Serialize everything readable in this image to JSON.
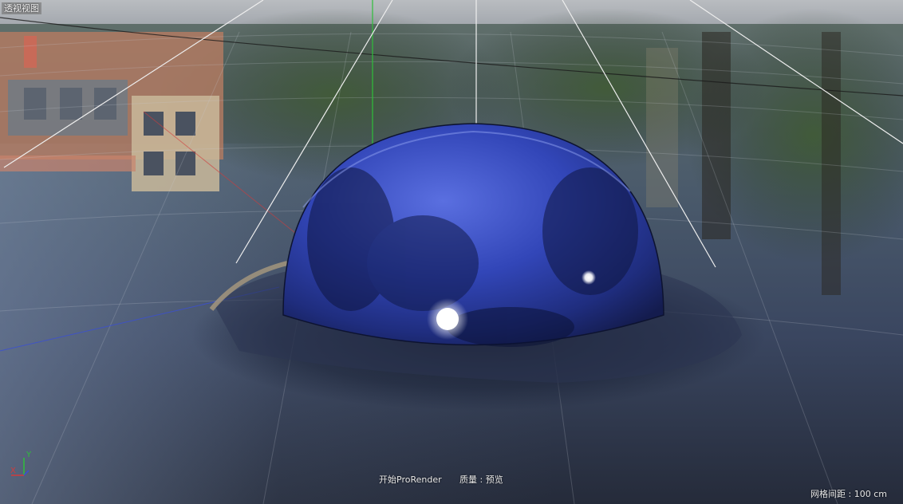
{
  "viewport": {
    "title": "透视视图"
  },
  "hud": {
    "render_start": "开始ProRender",
    "render_quality": "质量 : 预览",
    "grid_spacing": "网格间距 : 100 cm"
  },
  "axis_gizmo": {
    "x_label": "X",
    "y_label": "Y"
  },
  "colors": {
    "sky_top": "#aeb4ba",
    "floor_dark": "#2a3242",
    "floor_light": "#6a7f9a",
    "sphere_blue": "#2a3ea8",
    "axis_x": "#d23b3b",
    "axis_y": "#2fbf3a",
    "axis_z": "#3a4fd6"
  },
  "icons": {
    "sun_highlight": "sun-highlight-icon"
  }
}
